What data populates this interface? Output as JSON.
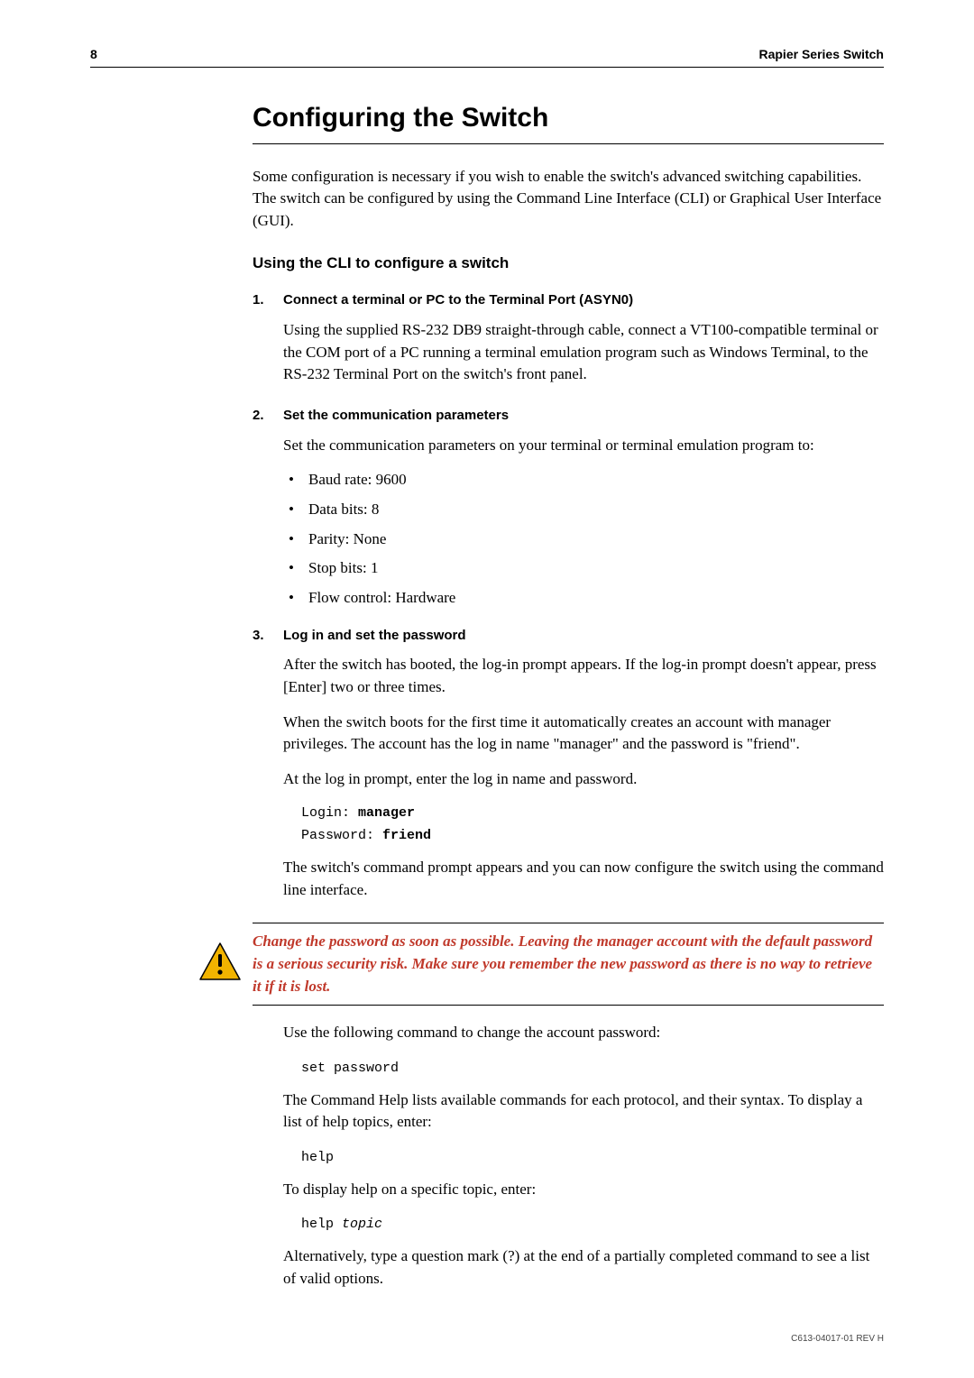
{
  "header": {
    "page_number": "8",
    "doc_title": "Rapier Series Switch"
  },
  "section_title": "Configuring the Switch",
  "intro_para": "Some configuration is necessary if you wish to enable the switch's advanced switching capabilities. The switch can be configured by using the Command Line Interface (CLI) or Graphical User Interface (GUI).",
  "subhead": "Using the CLI to configure a switch",
  "steps": [
    {
      "num": "1.",
      "title": "Connect a terminal or PC to the Terminal Port (ASYN0)",
      "para1": "Using the supplied RS-232 DB9 straight-through cable, connect a VT100-compatible terminal or the COM port of a PC running a terminal emulation program such as Windows Terminal, to the RS-232 Terminal Port on the switch's front panel."
    },
    {
      "num": "2.",
      "title": "Set the communication parameters",
      "para1": "Set the communication parameters on your terminal or terminal emulation program to:",
      "bullets": [
        "Baud rate: 9600",
        "Data bits: 8",
        "Parity: None",
        "Stop bits: 1",
        "Flow control: Hardware"
      ]
    },
    {
      "num": "3.",
      "title": "Log in and set the password",
      "para1": "After the switch has booted, the log-in prompt appears. If the log-in prompt doesn't appear, press [Enter] two or three times.",
      "para2": "When the switch boots for the first time it automatically creates an account with manager privileges. The account has the log in name \"manager\" and the password is \"friend\".",
      "para3": "At the log in prompt, enter the log in name and password.",
      "login_label": "Login: ",
      "login_value": "manager",
      "password_label": "Password: ",
      "password_value": "friend",
      "para4": "The switch's command prompt appears and you can now configure the switch using the command line interface."
    }
  ],
  "warning": "Change the password as soon as possible. Leaving the manager account with the default password is a serious security risk. Make sure you remember the new password as there is no way to retrieve it if it is lost.",
  "post": {
    "para1": "Use the following command to change the account password:",
    "code1": "set password",
    "para2": "The Command Help lists available commands for each protocol, and their syntax. To display a list of help topics, enter:",
    "code2": "help",
    "para3": "To display help on a specific topic, enter:",
    "code3_prefix": "help ",
    "code3_italic": "topic",
    "para4": "Alternatively, type a question mark (?) at the end of a partially completed command to see a list of valid options."
  },
  "footer": "C613-04017-01 REV H"
}
